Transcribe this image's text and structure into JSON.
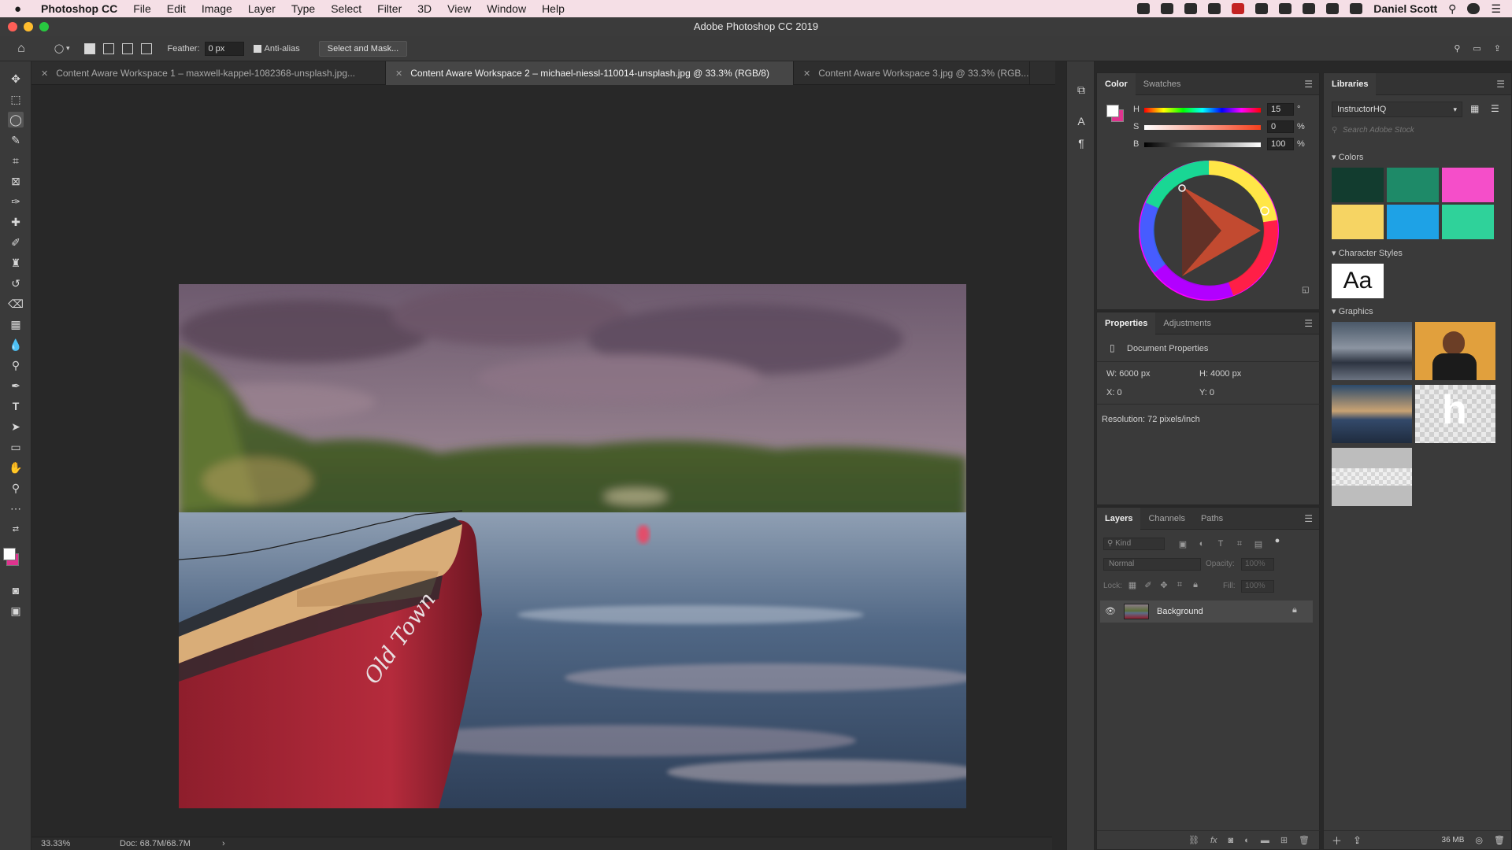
{
  "menubar": {
    "app": "Photoshop CC",
    "items": [
      "File",
      "Edit",
      "Image",
      "Layer",
      "Type",
      "Select",
      "Filter",
      "3D",
      "View",
      "Window",
      "Help"
    ],
    "user": "Daniel Scott"
  },
  "window": {
    "title": "Adobe Photoshop CC 2019"
  },
  "options": {
    "feather_label": "Feather:",
    "feather_value": "0 px",
    "antialias_label": "Anti-alias",
    "select_mask_label": "Select and Mask..."
  },
  "tabs": [
    "Content Aware Workspace 1 – maxwell-kappel-1082368-unsplash.jpg...",
    "Content Aware Workspace 2 – michael-niessl-110014-unsplash.jpg @ 33.3% (RGB/8)",
    "Content Aware Workspace 3.jpg @ 33.3% (RGB..."
  ],
  "status": {
    "zoom": "33.33%",
    "doc": "Doc: 68.7M/68.7M",
    "arrow": "›"
  },
  "color_panel": {
    "tabs": [
      "Color",
      "Swatches"
    ],
    "h_label": "H",
    "h_value": "15",
    "h_unit": "°",
    "s_label": "S",
    "s_value": "0",
    "s_unit": "%",
    "b_label": "B",
    "b_value": "100",
    "b_unit": "%"
  },
  "properties_panel": {
    "tabs": [
      "Properties",
      "Adjustments"
    ],
    "doc_props": "Document Properties",
    "w": "W: 6000 px",
    "h": "H: 4000 px",
    "x": "X: 0",
    "y": "Y: 0",
    "resolution": "Resolution: 72 pixels/inch"
  },
  "layers_panel": {
    "tabs": [
      "Layers",
      "Channels",
      "Paths"
    ],
    "kind": "Kind",
    "blend": "Normal",
    "opacity_label": "Opacity:",
    "opacity_value": "100%",
    "lock_label": "Lock:",
    "fill_label": "Fill:",
    "fill_value": "100%",
    "layer_name": "Background"
  },
  "libraries": {
    "title": "Libraries",
    "library": "InstructorHQ",
    "search_placeholder": "Search Adobe Stock",
    "colors_label": "Colors",
    "char_styles_label": "Character Styles",
    "char_sample": "Aa",
    "graphics_label": "Graphics",
    "size": "36 MB",
    "swatches": [
      "#123c2f",
      "#1e8a68",
      "#f54ec9",
      "#f6d463",
      "#1ea2e6",
      "#2fd29a"
    ]
  },
  "image": {
    "boat_text": "Old Town"
  },
  "colors": {
    "fg": "#ffffff",
    "bg": "#e0338f",
    "canvas": "#282828",
    "panel": "#3a3a3a"
  }
}
